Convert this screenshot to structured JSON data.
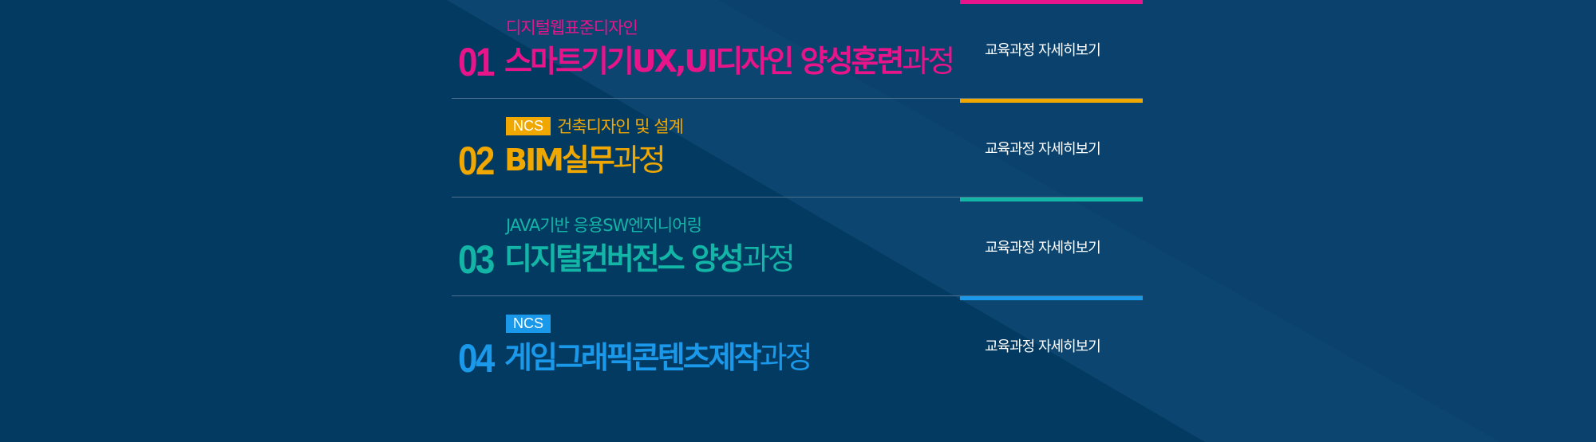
{
  "colors": {
    "background": "#033a62",
    "course_1": "#e8148a",
    "course_2": "#f0a800",
    "course_3": "#12b5a6",
    "course_4": "#1a98ea",
    "divider": "#4d7191"
  },
  "courses": [
    {
      "number": "01",
      "badge": "",
      "subtitle": "디지털웹표준디자인",
      "title_strong": "스마트기기UX,UI디자인 양성훈련",
      "title_light": "과정",
      "detail_label": "교육과정 자세히보기"
    },
    {
      "number": "02",
      "badge": "NCS",
      "subtitle": "건축디자인 및 설계",
      "title_strong": "BIM실무",
      "title_light": "과정",
      "detail_label": "교육과정 자세히보기"
    },
    {
      "number": "03",
      "badge": "",
      "subtitle": "JAVA기반 응용SW엔지니어링",
      "title_strong": "디지털컨버전스 양성",
      "title_light": "과정",
      "detail_label": "교육과정 자세히보기"
    },
    {
      "number": "04",
      "badge": "NCS",
      "subtitle": "",
      "title_strong": "게임그래픽콘텐츠제작",
      "title_light": "과정",
      "detail_label": "교육과정 자세히보기"
    }
  ]
}
